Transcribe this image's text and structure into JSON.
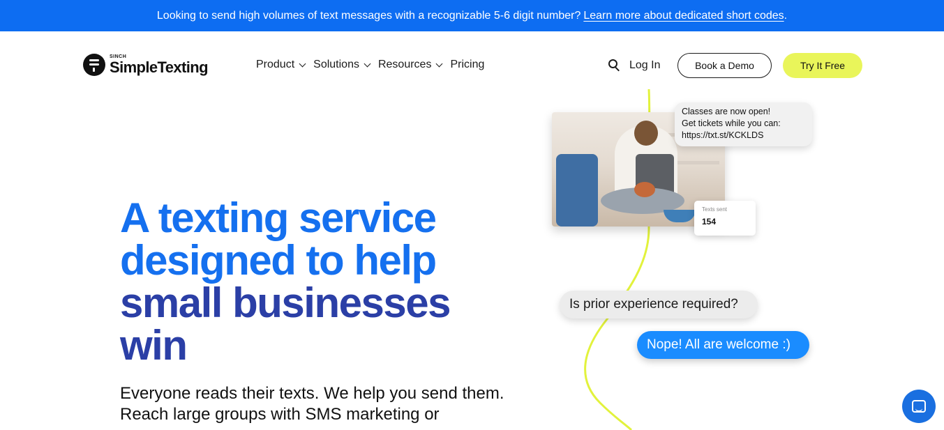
{
  "announcement": {
    "text": "Looking to send high volumes of text messages with a recognizable 5-6 digit number?",
    "link": "Learn more about dedicated short codes",
    "trailing": "."
  },
  "logo": {
    "small": "SINCH",
    "name": "SimpleTexting"
  },
  "nav": {
    "items": [
      {
        "label": "Product",
        "dropdown": true
      },
      {
        "label": "Solutions",
        "dropdown": true
      },
      {
        "label": "Resources",
        "dropdown": true
      },
      {
        "label": "Pricing",
        "dropdown": false
      }
    ],
    "login": "Log In",
    "demo": "Book a Demo",
    "try": "Try It Free"
  },
  "hero": {
    "title_line1": "A texting service",
    "title_line2": "designed to help",
    "title_line3": "small businesses",
    "title_line4": "win",
    "subtitle": "Everyone reads their texts. We help you send them. Reach large groups with SMS marketing or"
  },
  "illustration": {
    "bubble_open_line1": "Classes are now open!",
    "bubble_open_line2": "Get tickets while you can:",
    "bubble_open_line3": "https://txt.st/KCKLDS",
    "stat_label": "Texts sent",
    "stat_value": "154",
    "question": "Is prior experience required?",
    "answer": "Nope! All are welcome :)"
  },
  "colors": {
    "announce_bg": "#0d6df2",
    "title_blue": "#1570ef",
    "title_navy": "#2b3fa6",
    "cta_yellow": "#e9f55a",
    "vine": "#e2f23c",
    "reply_blue": "#1a8cff"
  }
}
